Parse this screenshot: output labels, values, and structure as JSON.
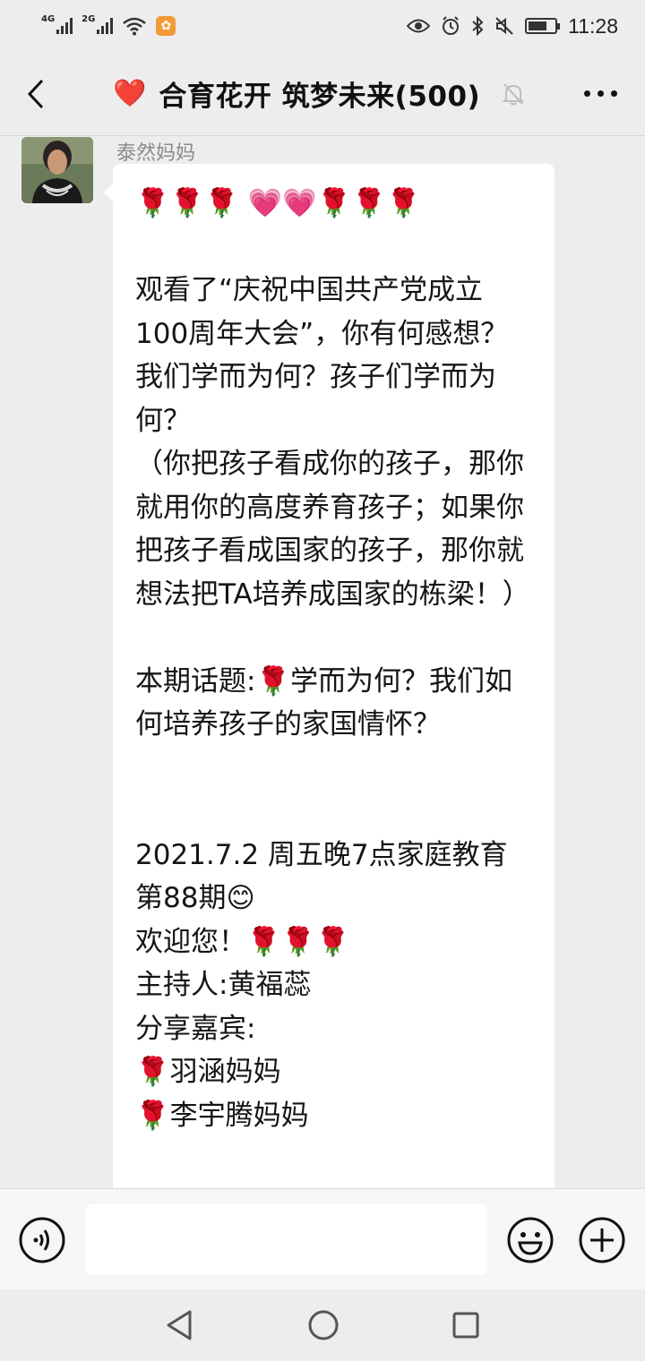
{
  "status_bar": {
    "net1": "4G",
    "net2": "2G",
    "time": "11:28",
    "battery_level": 0.7
  },
  "header": {
    "title_emoji": "❤️",
    "title": "合育花开 筑梦未来(500)",
    "icons": {
      "back": "chevron-left-icon",
      "mute": "bell-muted-icon",
      "more": "more-dots-icon"
    }
  },
  "chat": {
    "message": {
      "sender": "泰然妈妈",
      "text": "🌹🌹🌹 💗💗🌹🌹🌹\n\n观看了“庆祝中国共产党成立100周年大会”，你有何感想？我们学而为何？孩子们学而为何？\n（你把孩子看成你的孩子，那你就用你的高度养育孩子；如果你把孩子看成国家的孩子，那你就想法把TA培养成国家的栋梁！）\n\n本期话题:🌹学而为何？我们如何培养孩子的家国情怀？\n\n\n2021.7.2 周五晚7点家庭教育第88期😊\n欢迎您！🌹🌹🌹\n主持人:黄福蕊\n分享嘉宾:\n🌹羽涵妈妈\n🌹李宇腾妈妈"
    }
  },
  "input_bar": {
    "value": "",
    "icons": {
      "voice": "voice-icon",
      "emoji": "emoji-icon",
      "plus": "plus-icon"
    }
  },
  "nav_bar": {
    "icons": {
      "back": "triangle-back-icon",
      "home": "circle-home-icon",
      "recent": "square-recent-icon"
    }
  }
}
